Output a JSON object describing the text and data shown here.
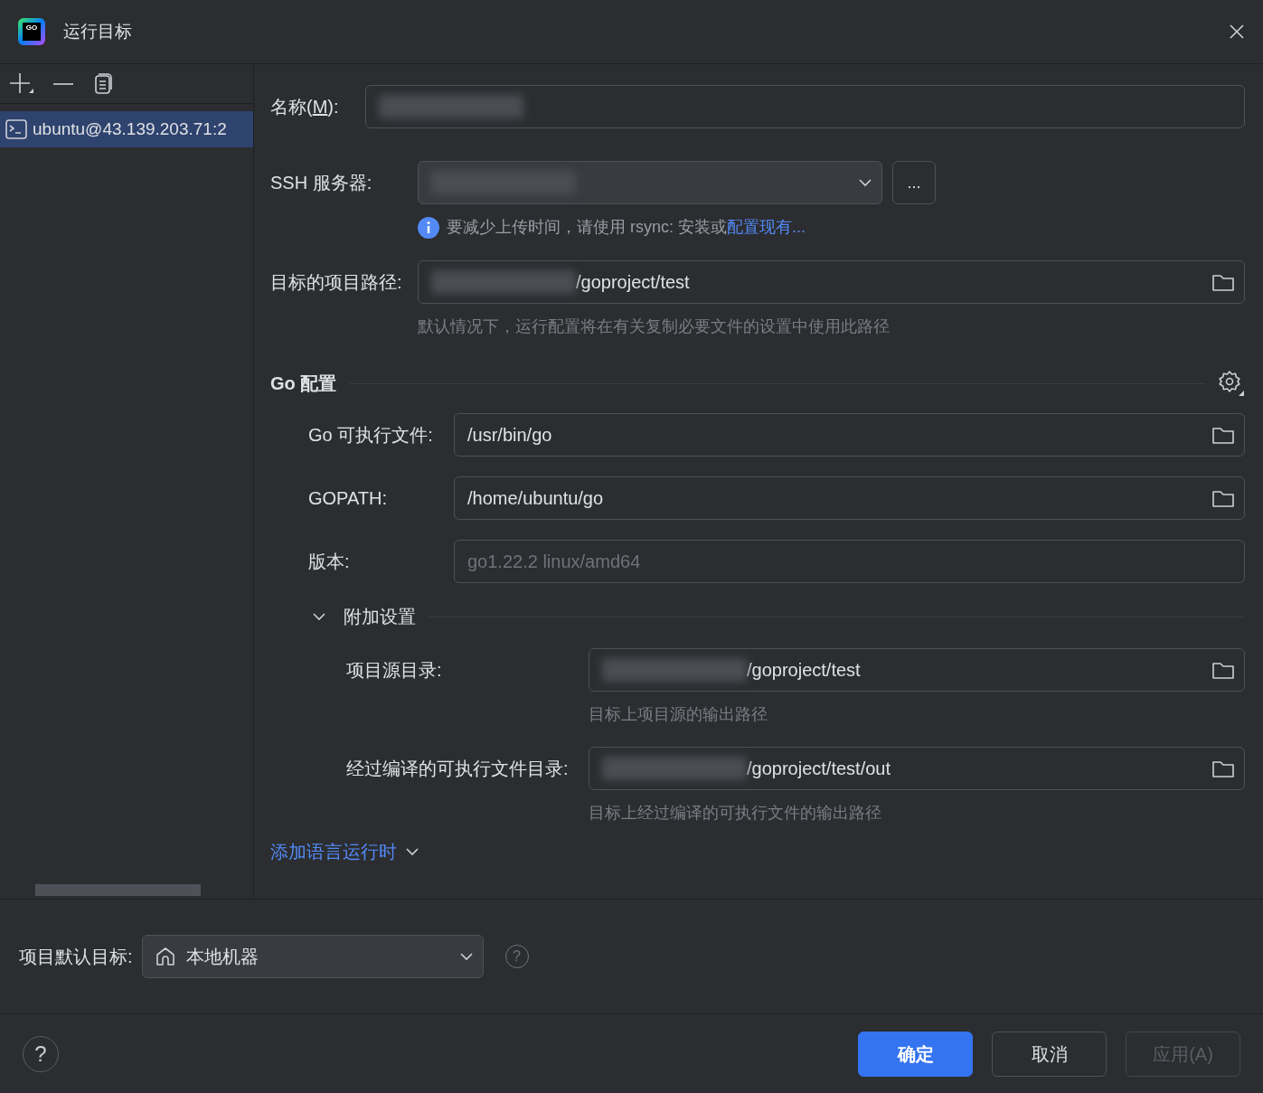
{
  "window": {
    "title": "运行目标",
    "logo_text": "GO"
  },
  "sidebar": {
    "items": [
      {
        "label": "ubuntu@43.139.203.71:2",
        "selected": true
      }
    ]
  },
  "name_field": {
    "label_before": "名称(",
    "label_mnemonic": "M",
    "label_after": "):",
    "redacted": true
  },
  "ssh_field": {
    "label": "SSH 服务器:",
    "redacted": true,
    "button": "...",
    "info_text": "要减少上传时间，请使用 rsync: 安装或",
    "info_link": "配置现有..."
  },
  "path_field": {
    "label": "目标的项目路径:",
    "redacted": true,
    "value": "/goproject/test",
    "hint": "默认情况下，运行配置将在有关复制必要文件的设置中使用此路径"
  },
  "go_section": {
    "title": "Go 配置",
    "fields": [
      {
        "label": "Go 可执行文件:",
        "value": "/usr/bin/go",
        "disabled": false,
        "browse": true
      },
      {
        "label": "GOPATH:",
        "value": "/home/ubuntu/go",
        "disabled": false,
        "browse": true
      },
      {
        "label": "版本:",
        "value": "go1.22.2 linux/amd64",
        "disabled": true,
        "browse": false
      }
    ]
  },
  "additional": {
    "title": "附加设置",
    "expanded": true,
    "fields": [
      {
        "label": "项目源目录:",
        "redacted": true,
        "value": "/goproject/test",
        "hint": "目标上项目源的输出路径"
      },
      {
        "label": "经过编译的可执行文件目录:",
        "redacted": true,
        "value": "/goproject/test/out",
        "hint": "目标上经过编译的可执行文件的输出路径"
      }
    ]
  },
  "add_runtime_link": "添加语言运行时",
  "default_target": {
    "label": "项目默认目标:",
    "value": "本地机器",
    "help": "?"
  },
  "help_button": "?",
  "buttons": [
    {
      "label": "确定",
      "kind": "primary",
      "disabled": false
    },
    {
      "label": "取消",
      "kind": "secondary",
      "disabled": false
    },
    {
      "label": "应用(A)",
      "kind": "secondary",
      "disabled": true
    }
  ]
}
